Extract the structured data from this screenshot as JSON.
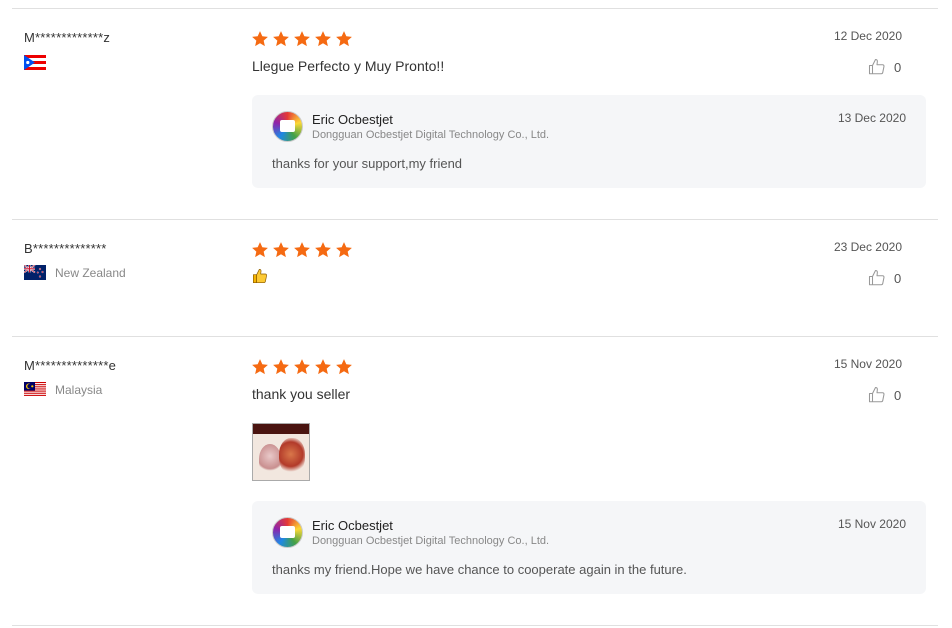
{
  "colors": {
    "star": "#f56a12",
    "divider": "#e0e0e0",
    "reply_bg": "#f5f6f8"
  },
  "reviews": [
    {
      "username": "M*************z",
      "country": "",
      "flag": "puerto-rico-flag",
      "rating": 5,
      "date": "12 Dec 2020",
      "text": "Llegue Perfecto y Muy Pronto!!",
      "likes": "0",
      "reply": {
        "name": "Eric Ocbestjet",
        "company": "Dongguan Ocbestjet Digital Technology Co., Ltd.",
        "date": "13 Dec 2020",
        "text": "thanks for your support,my friend"
      }
    },
    {
      "username": "B**************",
      "country": "New Zealand",
      "flag": "new-zealand-flag",
      "rating": 5,
      "date": "23 Dec 2020",
      "text": "",
      "emoji": "thumbs-up-emoji",
      "likes": "0"
    },
    {
      "username": "M**************e",
      "country": "Malaysia",
      "flag": "malaysia-flag",
      "rating": 5,
      "date": "15 Nov 2020",
      "text": "thank you seller",
      "likes": "0",
      "photo": "review-photo-thumbnail",
      "reply": {
        "name": "Eric Ocbestjet",
        "company": "Dongguan Ocbestjet Digital Technology Co., Ltd.",
        "date": "15 Nov 2020",
        "text": "thanks my friend.Hope we have chance to cooperate again in the future."
      }
    }
  ]
}
